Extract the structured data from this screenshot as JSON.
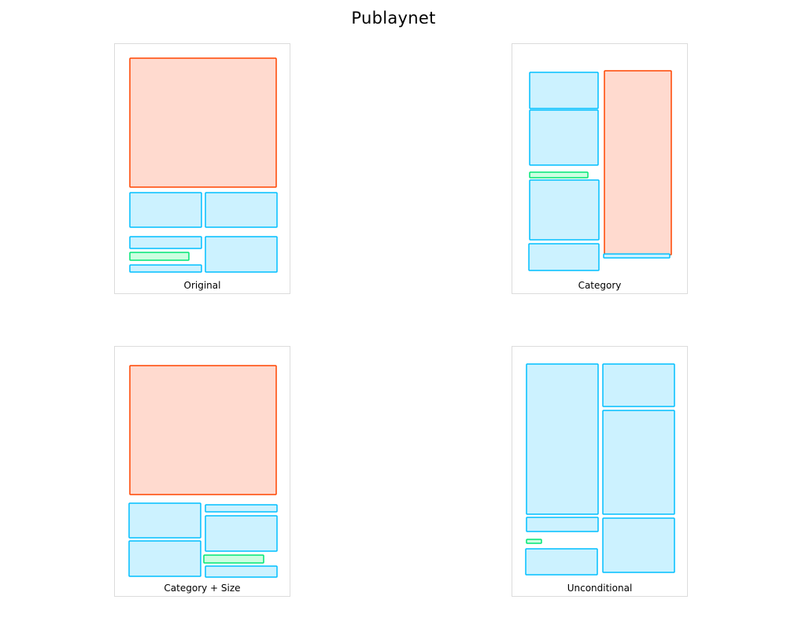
{
  "title": "Publaynet",
  "colors": {
    "figure": {
      "stroke": "#ff4500",
      "fill": "#ffdacf"
    },
    "text": {
      "stroke": "#00bfff",
      "fill": "#ccf2ff"
    },
    "title": {
      "stroke": "#00e676",
      "fill": "#ccffe0"
    }
  },
  "panels": [
    {
      "label": "Original",
      "boxes": [
        {
          "category": "figure"
        },
        {
          "category": "text"
        },
        {
          "category": "text"
        },
        {
          "category": "text"
        },
        {
          "category": "title"
        },
        {
          "category": "text"
        },
        {
          "category": "text"
        }
      ]
    },
    {
      "label": "Category",
      "boxes": [
        {
          "category": "text"
        },
        {
          "category": "text"
        },
        {
          "category": "title"
        },
        {
          "category": "text"
        },
        {
          "category": "text"
        },
        {
          "category": "figure"
        },
        {
          "category": "text"
        }
      ]
    },
    {
      "label": "Category + Size",
      "boxes": [
        {
          "category": "figure"
        },
        {
          "category": "text"
        },
        {
          "category": "text"
        },
        {
          "category": "text"
        },
        {
          "category": "text"
        },
        {
          "category": "title"
        },
        {
          "category": "text"
        }
      ]
    },
    {
      "label": "Unconditional",
      "boxes": [
        {
          "category": "text"
        },
        {
          "category": "text"
        },
        {
          "category": "text"
        },
        {
          "category": "text"
        },
        {
          "category": "title"
        },
        {
          "category": "text"
        },
        {
          "category": "text"
        }
      ]
    }
  ]
}
